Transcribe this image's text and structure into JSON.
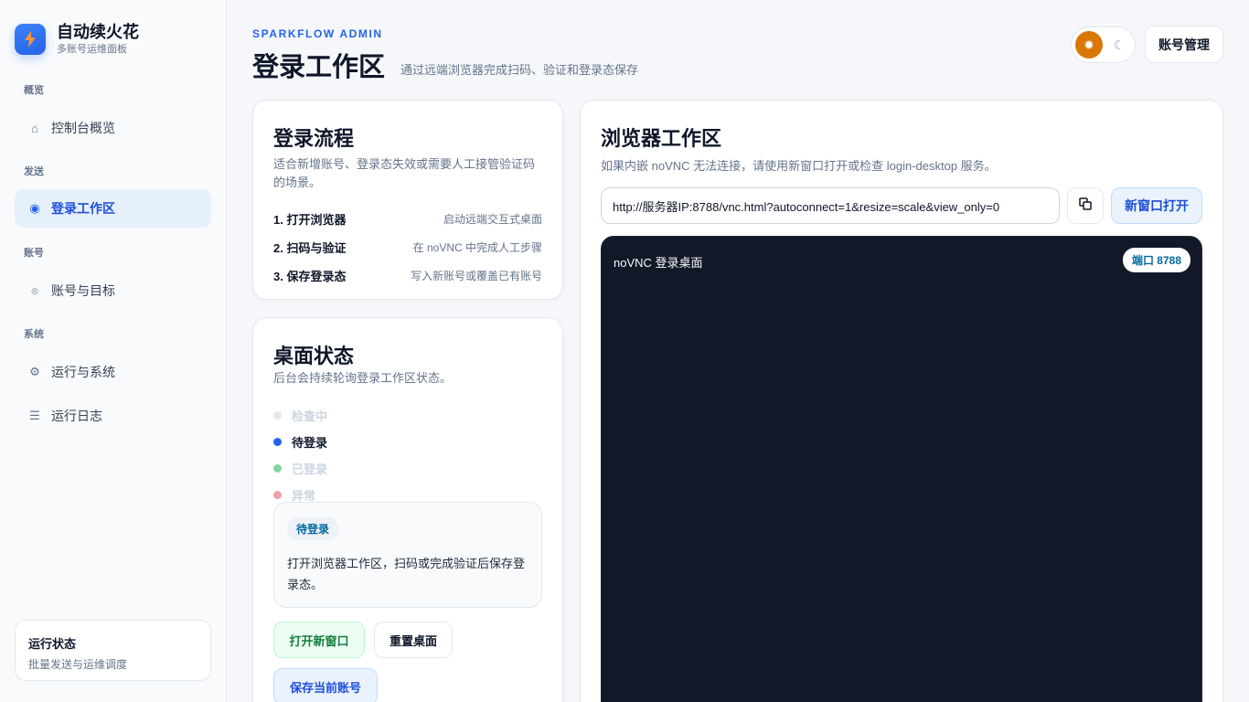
{
  "brand": {
    "title": "自动续火花",
    "subtitle": "多账号运维面板"
  },
  "sidebar": {
    "sections": [
      {
        "label": "概览"
      },
      {
        "label": "发送"
      },
      {
        "label": "账号"
      },
      {
        "label": "系统"
      }
    ],
    "items": [
      {
        "label": "控制台概览",
        "icon": "home-icon"
      },
      {
        "label": "登录工作区",
        "icon": "dot-icon"
      },
      {
        "label": "账号与目标",
        "icon": "target-icon"
      },
      {
        "label": "运行与系统",
        "icon": "gear-icon"
      },
      {
        "label": "运行日志",
        "icon": "list-icon"
      }
    ],
    "run_card": {
      "title": "运行状态",
      "subtitle": "批量发送与运维调度"
    }
  },
  "header": {
    "eyebrow": "SPARKFLOW ADMIN",
    "title": "登录工作区",
    "subtitle": "通过远端浏览器完成扫码、验证和登录态保存",
    "account_button": "账号管理"
  },
  "flow": {
    "title": "登录流程",
    "desc": "适合新增账号、登录态失效或需要人工接管验证码的场景。",
    "steps": [
      {
        "name": "1. 打开浏览器",
        "hint": "启动远端交互式桌面"
      },
      {
        "name": "2. 扫码与验证",
        "hint": "在 noVNC 中完成人工步骤"
      },
      {
        "name": "3. 保存登录态",
        "hint": "写入新账号或覆盖已有账号"
      }
    ]
  },
  "desktop": {
    "title": "桌面状态",
    "desc": "后台会持续轮询登录工作区状态。",
    "statuses": [
      {
        "label": "检查中",
        "color": "#e2e8f0",
        "text_color": "#cbd5e1"
      },
      {
        "label": "待登录",
        "color": "#2563eb",
        "text_color": "#0f172a"
      },
      {
        "label": "已登录",
        "color": "#86d4a5",
        "text_color": "#cbd5e1"
      },
      {
        "label": "异常",
        "color": "#f0a0a8",
        "text_color": "#cbd5e1"
      }
    ],
    "current_badge": "待登录",
    "current_message": "打开浏览器工作区，扫码或完成验证后保存登录态。",
    "btn_open": "打开新窗口",
    "btn_reset": "重置桌面",
    "btn_save": "保存当前账号"
  },
  "browser": {
    "title": "浏览器工作区",
    "desc": "如果内嵌 noVNC 无法连接，请使用新窗口打开或检查 login-desktop 服务。",
    "url": "http://服务器IP:8788/vnc.html?autoconnect=1&resize=scale&view_only=0",
    "open_button": "新窗口打开",
    "vnc_title": "noVNC 登录桌面",
    "port_badge": "端口 8788"
  },
  "colors": {
    "accent": "#2563eb",
    "sun": "#d97706",
    "vnc_bg": "#111827"
  }
}
